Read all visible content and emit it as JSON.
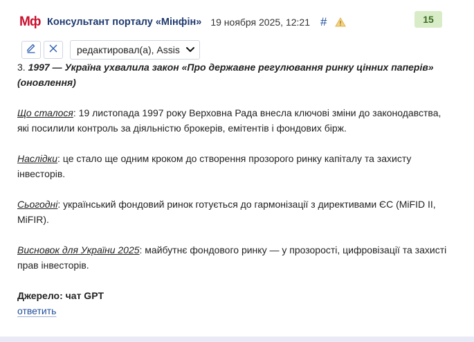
{
  "header": {
    "logo": "Мф",
    "author": "Консультант порталу «Мінфін»",
    "datetime": "19 ноября 2025, 12:21",
    "hash": "#",
    "rating": "15"
  },
  "toolbar": {
    "edited_by": "редактировал(а), Assis"
  },
  "post": {
    "title_num": "3.",
    "title": "1997 — Україна ухвалила закон «Про державне регулювання ринку цінних паперів» (оновлення)",
    "paragraphs": [
      {
        "label": "Що сталося",
        "text": ": 19 листопада 1997 року Верховна Рада внесла ключові зміни до законодавства, які посилили контроль за діяльністю брокерів, емітентів і фондових бірж."
      },
      {
        "label": "Наслідки",
        "text": ": це стало ще одним кроком до створення прозорого ринку капіталу та захисту інвесторів."
      },
      {
        "label": "Сьогодні",
        "text": ": український фондовий ринок готується до гармонізації з директивами ЄС (MiFID II, MiFIR)."
      },
      {
        "label": "Висновок для України 2025",
        "text": ": майбутнє фондового ринку — у прозорості, цифровізації та захисті прав інвесторів."
      }
    ],
    "source": "Джерело: чат GPT",
    "reply": "ответить"
  },
  "icons": {
    "edit": "pencil-icon",
    "delete": "close-icon",
    "warning": "warning-icon",
    "dropdown": "chevron-down-icon"
  },
  "colors": {
    "brand": "#c8102e",
    "author": "#1f3a70",
    "link": "#1f4d9c",
    "badge_bg": "#d7ecc7",
    "badge_text": "#3a6b1f"
  }
}
